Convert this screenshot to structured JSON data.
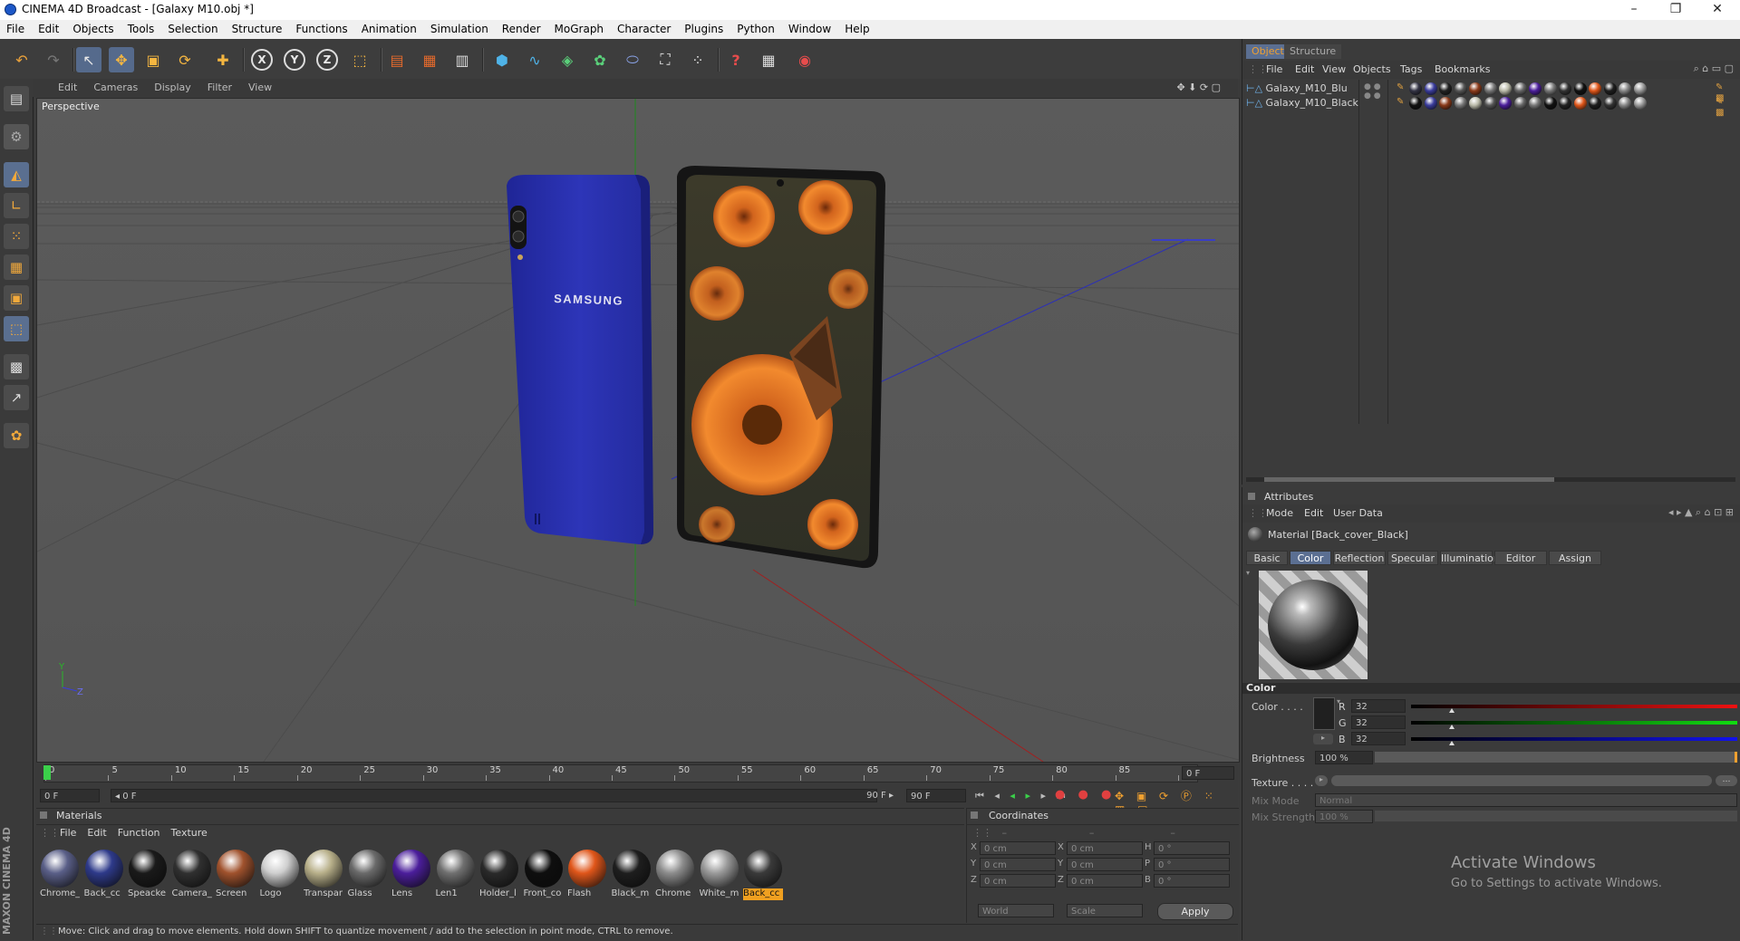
{
  "window": {
    "title": "CINEMA 4D Broadcast - [Galaxy M10.obj *]",
    "minimize": "–",
    "maximize": "❐",
    "close": "✕"
  },
  "menu": [
    "File",
    "Edit",
    "Objects",
    "Tools",
    "Selection",
    "Structure",
    "Functions",
    "Animation",
    "Simulation",
    "Render",
    "MoGraph",
    "Character",
    "Plugins",
    "Python",
    "Window",
    "Help"
  ],
  "toolbar": {
    "icons": [
      "undo-icon",
      "redo-icon",
      "select-icon",
      "move-icon",
      "scale-icon",
      "rotate-icon",
      "add-icon",
      "x-axis-icon",
      "y-axis-icon",
      "z-axis-icon",
      "coordinate-system-icon",
      "render-view-icon",
      "render-picture-icon",
      "render-settings-icon",
      "cube-icon",
      "spline-icon",
      "nurbs-icon",
      "array-icon",
      "deformer-icon",
      "scene-icon",
      "particles-icon",
      "help-icon",
      "layout-icon",
      "globe-icon"
    ],
    "axis_x": "X",
    "axis_y": "Y",
    "axis_z": "Z",
    "help": "?"
  },
  "viewport": {
    "menu": [
      "Edit",
      "Cameras",
      "Display",
      "Filter",
      "View"
    ],
    "camera_label": "Perspective",
    "brand_text": "SAMSUNG",
    "axis_y": "Y",
    "axis_z": "Z"
  },
  "timeline": {
    "ticks": [
      "0",
      "5",
      "10",
      "15",
      "20",
      "25",
      "30",
      "35",
      "40",
      "45",
      "50",
      "55",
      "60",
      "65",
      "70",
      "75",
      "80",
      "85",
      "90"
    ],
    "current_frame": "0 F",
    "start_field": "0 F",
    "min_field": "◂ 0 F",
    "max_field": "90 F ▸",
    "end_field": "90 F"
  },
  "materials": {
    "title": "Materials",
    "menu": [
      "File",
      "Edit",
      "Function",
      "Texture"
    ],
    "items": [
      {
        "name": "Chrome_",
        "color": "#5a5f88"
      },
      {
        "name": "Back_cc",
        "color": "#2e3a8a"
      },
      {
        "name": "Speacke",
        "color": "#1a1a1a"
      },
      {
        "name": "Camera_",
        "color": "#303030"
      },
      {
        "name": "Screen",
        "color": "#a0522d"
      },
      {
        "name": "Logo",
        "color": "#cfcfcf"
      },
      {
        "name": "Transpar",
        "color": "#b8b08a"
      },
      {
        "name": "Glass",
        "color": "#6a6a6a"
      },
      {
        "name": "Lens",
        "color": "#4b1e9b"
      },
      {
        "name": "Len1",
        "color": "#707070"
      },
      {
        "name": "Holder_l",
        "color": "#2a2a2a"
      },
      {
        "name": "Front_co",
        "color": "#0e0e0e"
      },
      {
        "name": "Flash",
        "color": "#e0561a"
      },
      {
        "name": "Black_m",
        "color": "#1e1e1e"
      },
      {
        "name": "Chrome",
        "color": "#8c8c8c"
      },
      {
        "name": "White_m",
        "color": "#9a9a9a"
      },
      {
        "name": "Back_cc",
        "color": "#3a3a3a"
      }
    ]
  },
  "coordinates": {
    "title": "Coordinates",
    "rows": [
      {
        "l1": "X",
        "v1": "0 cm",
        "l2": "X",
        "v2": "0 cm",
        "l3": "H",
        "v3": "0 °"
      },
      {
        "l1": "Y",
        "v1": "0 cm",
        "l2": "Y",
        "v2": "0 cm",
        "l3": "P",
        "v3": "0 °"
      },
      {
        "l1": "Z",
        "v1": "0 cm",
        "l2": "Z",
        "v2": "0 cm",
        "l3": "B",
        "v3": "0 °"
      }
    ],
    "mode1": "World",
    "mode2": "Scale",
    "apply": "Apply"
  },
  "status": "Move: Click and drag to move elements. Hold down SHIFT to quantize movement / add to the selection in point mode, CTRL to remove.",
  "maxon": "MAXON CINEMA 4D",
  "objects": {
    "tabs": [
      "Objects",
      "Structure"
    ],
    "menu": [
      "File",
      "Edit",
      "View",
      "Objects",
      "Tags",
      "Bookmarks"
    ],
    "items": [
      "Galaxy_M10_Blu",
      "Galaxy_M10_Black"
    ]
  },
  "attributes": {
    "title": "Attributes",
    "menu": [
      "Mode",
      "Edit",
      "User Data"
    ],
    "material_name": "Material [Back_cover_Black]",
    "tabs": [
      "Basic",
      "Color",
      "Reflection",
      "Specular",
      "Illumination",
      "Editor",
      "Assign"
    ],
    "active_tab": "Color",
    "section": "Color",
    "color_label": "Color . . . .",
    "r_label": "R",
    "r_value": "32",
    "g_label": "G",
    "g_value": "32",
    "b_label": "B",
    "b_value": "32",
    "brightness_label": "Brightness",
    "brightness_value": "100 %",
    "brightness_fraction": 1.0,
    "color_fraction": 0.125,
    "texture_label": "Texture . . . .",
    "mixmode_label": "Mix Mode",
    "mixmode_value": "Normal",
    "mixstrength_label": "Mix Strength",
    "mixstrength_value": "100 %"
  },
  "watermark": {
    "line1": "Activate Windows",
    "line2": "Go to Settings to activate Windows."
  }
}
